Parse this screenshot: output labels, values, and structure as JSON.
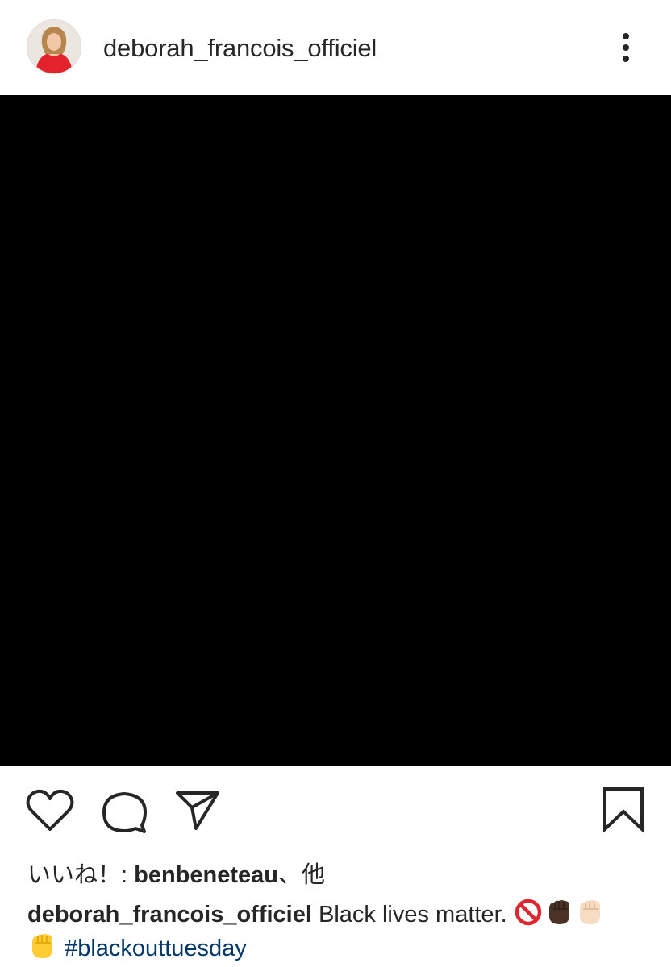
{
  "post": {
    "username": "deborah_francois_officiel",
    "likes": {
      "prefix": "いいね！: ",
      "liker": "benbeneteau",
      "suffix": "、他"
    },
    "caption": {
      "username": "deborah_francois_officiel",
      "text": " Black lives matter. ",
      "hashtag": "#blackouttuesday"
    },
    "image_color": "#000000"
  },
  "icons": {
    "avatar": "profile-photo",
    "more": "vertical-ellipsis-icon",
    "like": "heart-icon",
    "comment": "comment-bubble-icon",
    "share": "paper-plane-icon",
    "save": "bookmark-icon",
    "emojis": [
      "no-entry-sign",
      "raised-fist-dark-skin",
      "raised-fist-light-skin",
      "raised-fist"
    ]
  },
  "colors": {
    "text": "#262626",
    "hashtag": "#00376b",
    "background": "#ffffff"
  }
}
